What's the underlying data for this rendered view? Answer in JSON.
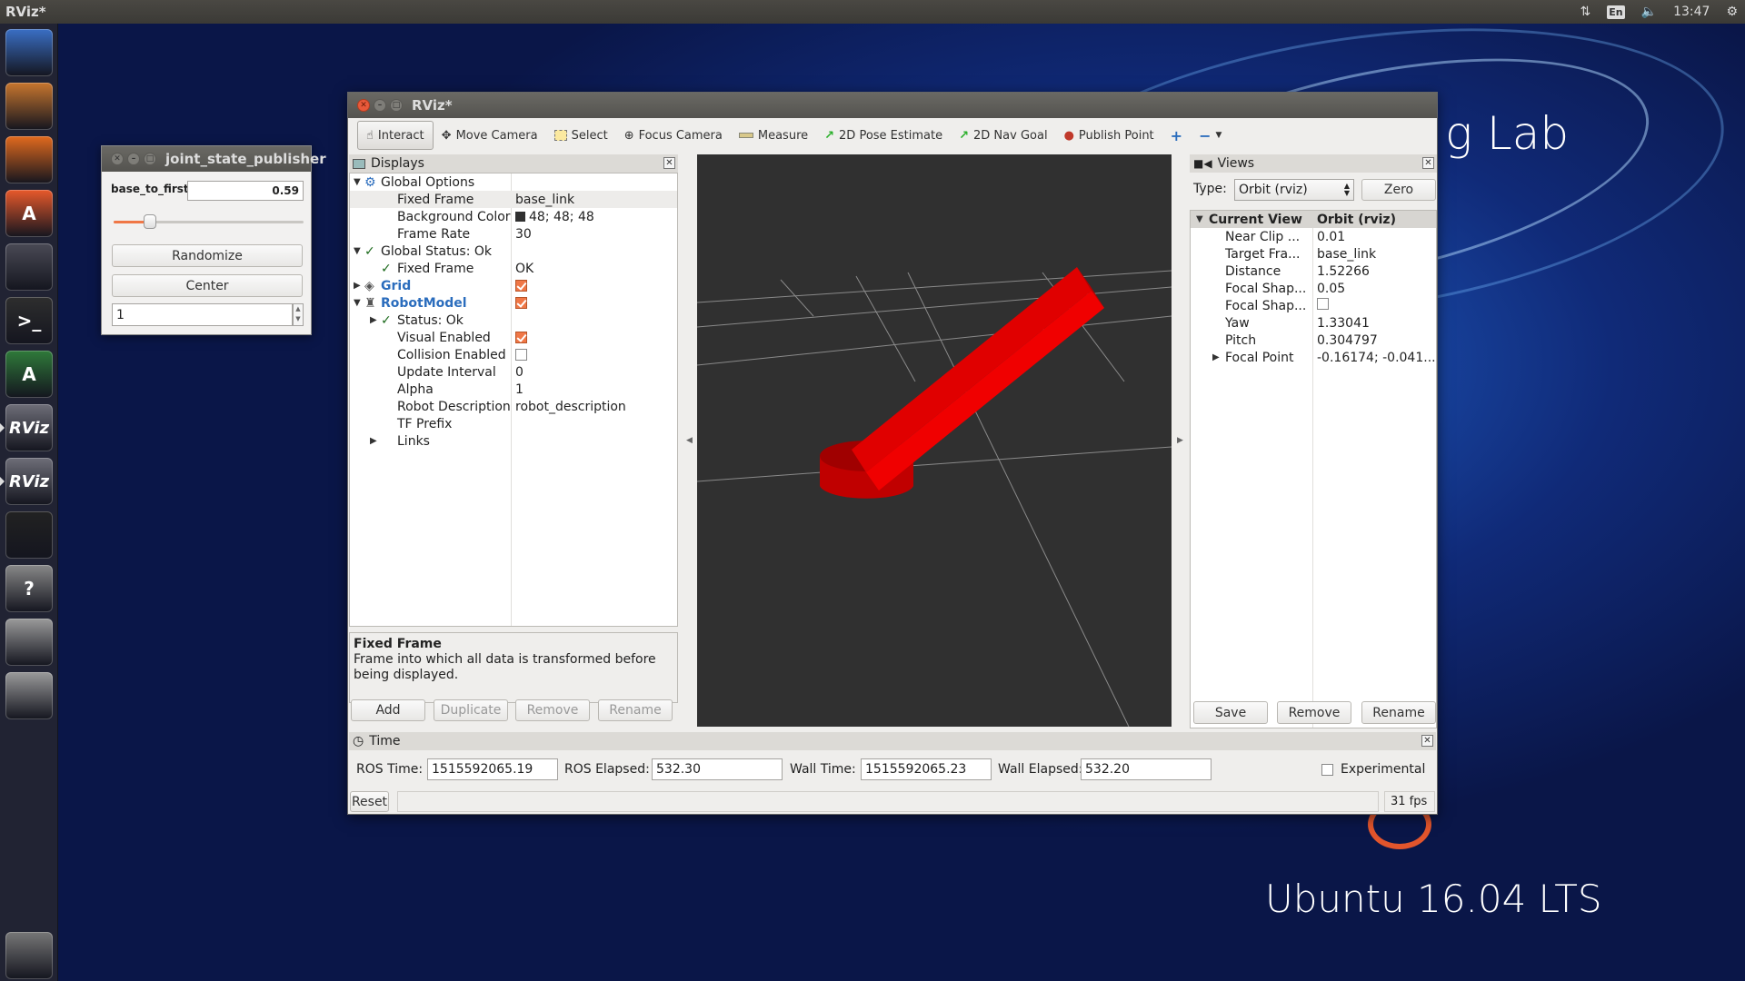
{
  "topbar": {
    "title": "RViz*",
    "lang": "En",
    "time": "13:47"
  },
  "launcher": {
    "items": [
      {
        "name": "ubuntu-dash-icon",
        "label": ""
      },
      {
        "name": "files-icon",
        "label": ""
      },
      {
        "name": "firefox-icon",
        "label": ""
      },
      {
        "name": "software-center-icon",
        "label": "A"
      },
      {
        "name": "system-settings-icon",
        "label": ""
      },
      {
        "name": "terminal-icon",
        "label": ">_"
      },
      {
        "name": "software-updater-icon",
        "label": "A"
      },
      {
        "name": "rviz-icon",
        "label": "RViz"
      },
      {
        "name": "rviz-icon",
        "label": "RViz"
      },
      {
        "name": "app-icon",
        "label": ""
      },
      {
        "name": "help-icon",
        "label": "?"
      },
      {
        "name": "drive-icon",
        "label": ""
      },
      {
        "name": "drive-icon",
        "label": ""
      },
      {
        "name": "trash-icon",
        "label": ""
      }
    ]
  },
  "wallpaper": {
    "brand": "g Lab",
    "os": "Ubuntu 16.04 LTS"
  },
  "jsp": {
    "title": "joint_state_publisher",
    "joint_label": "base_to_first",
    "joint_value": "0.59",
    "slider_fraction": 0.19,
    "randomize": "Randomize",
    "center": "Center",
    "spin_value": "1"
  },
  "rviz": {
    "title": "RViz*",
    "toolbar": [
      "Interact",
      "Move Camera",
      "Select",
      "Focus Camera",
      "Measure",
      "2D Pose Estimate",
      "2D Nav Goal",
      "Publish Point"
    ],
    "displays": {
      "title": "Displays",
      "rows": [
        {
          "indent": 0,
          "arrow": "▼",
          "icon": "gear",
          "label": "Global Options",
          "value": ""
        },
        {
          "indent": 1,
          "arrow": "",
          "icon": "",
          "label": "Fixed Frame",
          "value": "base_link",
          "selected": true
        },
        {
          "indent": 1,
          "arrow": "",
          "icon": "",
          "label": "Background Color",
          "value": "48; 48; 48",
          "swatch": "#303030"
        },
        {
          "indent": 1,
          "arrow": "",
          "icon": "",
          "label": "Frame Rate",
          "value": "30"
        },
        {
          "indent": 0,
          "arrow": "▼",
          "icon": "check",
          "label": "Global Status: Ok",
          "value": ""
        },
        {
          "indent": 1,
          "arrow": "",
          "icon": "check",
          "label": "Fixed Frame",
          "value": "OK"
        },
        {
          "indent": 0,
          "arrow": "▶",
          "icon": "grid",
          "label": "Grid",
          "value": "",
          "blue": true,
          "cb": true
        },
        {
          "indent": 0,
          "arrow": "▼",
          "icon": "robot",
          "label": "RobotModel",
          "value": "",
          "blue": true,
          "cb": true
        },
        {
          "indent": 1,
          "arrow": "▶",
          "icon": "check",
          "label": "Status: Ok",
          "value": ""
        },
        {
          "indent": 1,
          "arrow": "",
          "icon": "",
          "label": "Visual Enabled",
          "value": "",
          "cb": true
        },
        {
          "indent": 1,
          "arrow": "",
          "icon": "",
          "label": "Collision Enabled",
          "value": "",
          "cb": false
        },
        {
          "indent": 1,
          "arrow": "",
          "icon": "",
          "label": "Update Interval",
          "value": "0"
        },
        {
          "indent": 1,
          "arrow": "",
          "icon": "",
          "label": "Alpha",
          "value": "1"
        },
        {
          "indent": 1,
          "arrow": "",
          "icon": "",
          "label": "Robot Description",
          "value": "robot_description"
        },
        {
          "indent": 1,
          "arrow": "",
          "icon": "",
          "label": "TF Prefix",
          "value": ""
        },
        {
          "indent": 1,
          "arrow": "▶",
          "icon": "",
          "label": "Links",
          "value": ""
        }
      ],
      "help_title": "Fixed Frame",
      "help_text": "Frame into which all data is transformed before being displayed.",
      "buttons": [
        "Add",
        "Duplicate",
        "Remove",
        "Rename"
      ]
    },
    "views": {
      "title": "Views",
      "type_label": "Type:",
      "type_value": "Orbit (rviz)",
      "zero": "Zero",
      "header": {
        "label": "Current View",
        "value": "Orbit (rviz)"
      },
      "rows": [
        {
          "label": "Near Clip ...",
          "value": "0.01"
        },
        {
          "label": "Target Fra...",
          "value": "base_link"
        },
        {
          "label": "Distance",
          "value": "1.52266"
        },
        {
          "label": "Focal Shap...",
          "value": "0.05"
        },
        {
          "label": "Focal Shap...",
          "value": "",
          "cb": true
        },
        {
          "label": "Yaw",
          "value": "1.33041"
        },
        {
          "label": "Pitch",
          "value": "0.304797"
        },
        {
          "label": "Focal Point",
          "value": "-0.16174; -0.041...",
          "arrow": true
        }
      ],
      "buttons": [
        "Save",
        "Remove",
        "Rename"
      ]
    },
    "time": {
      "title": "Time",
      "ros_time_label": "ROS Time:",
      "ros_time": "1515592065.19",
      "ros_elapsed_label": "ROS Elapsed:",
      "ros_elapsed": "532.30",
      "wall_time_label": "Wall Time:",
      "wall_time": "1515592065.23",
      "wall_elapsed_label": "Wall Elapsed:",
      "wall_elapsed": "532.20",
      "experimental": "Experimental",
      "reset": "Reset",
      "fps": "31 fps"
    }
  }
}
